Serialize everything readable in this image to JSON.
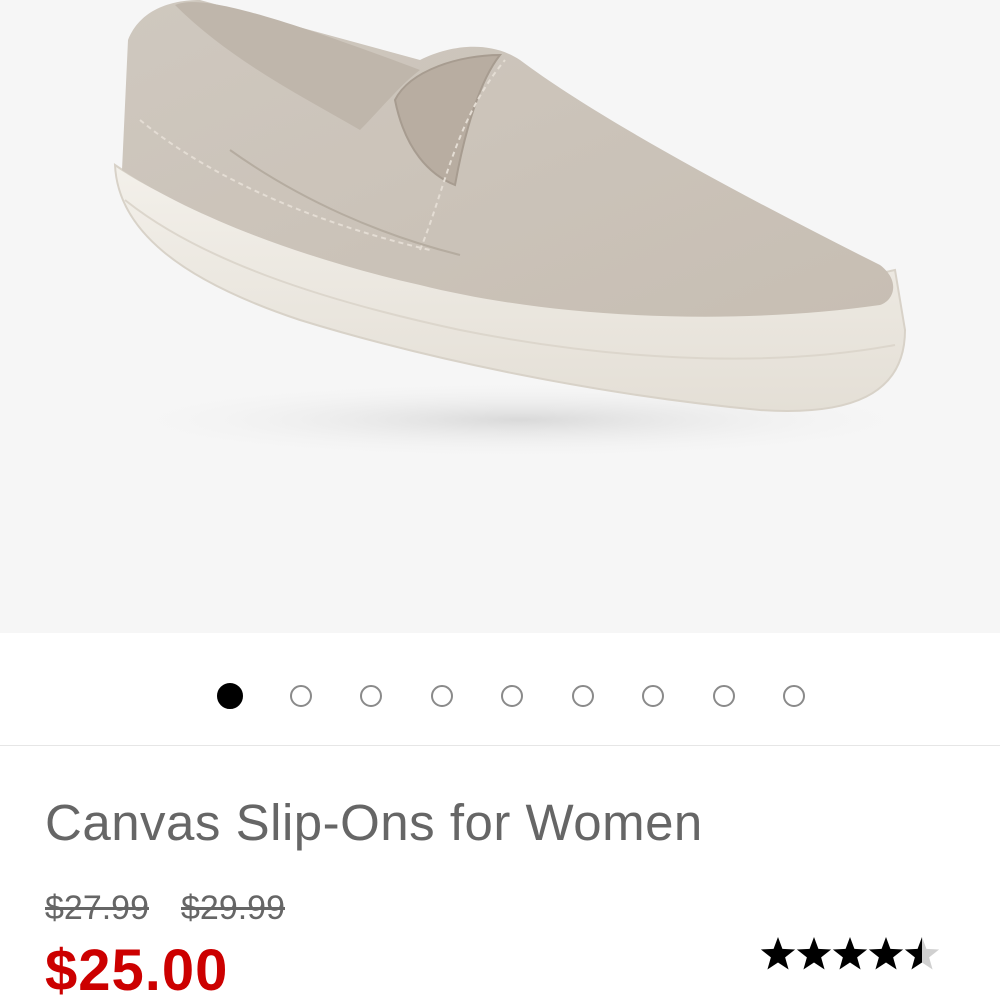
{
  "product": {
    "title": "Canvas Slip-Ons for Women",
    "prices": {
      "original_1": "$27.99",
      "original_2": "$29.99",
      "sale": "$25.00"
    },
    "rating": 4.5,
    "rating_max": 5
  },
  "gallery": {
    "image_count": 9,
    "active_index": 0,
    "image_name": "canvas-slip-on-shoe-image"
  },
  "colors": {
    "sale_price": "#cc0000",
    "text_gray": "#666666",
    "star": "#000000"
  },
  "icons": {
    "star_full": "star-icon",
    "star_half": "star-half-icon"
  }
}
